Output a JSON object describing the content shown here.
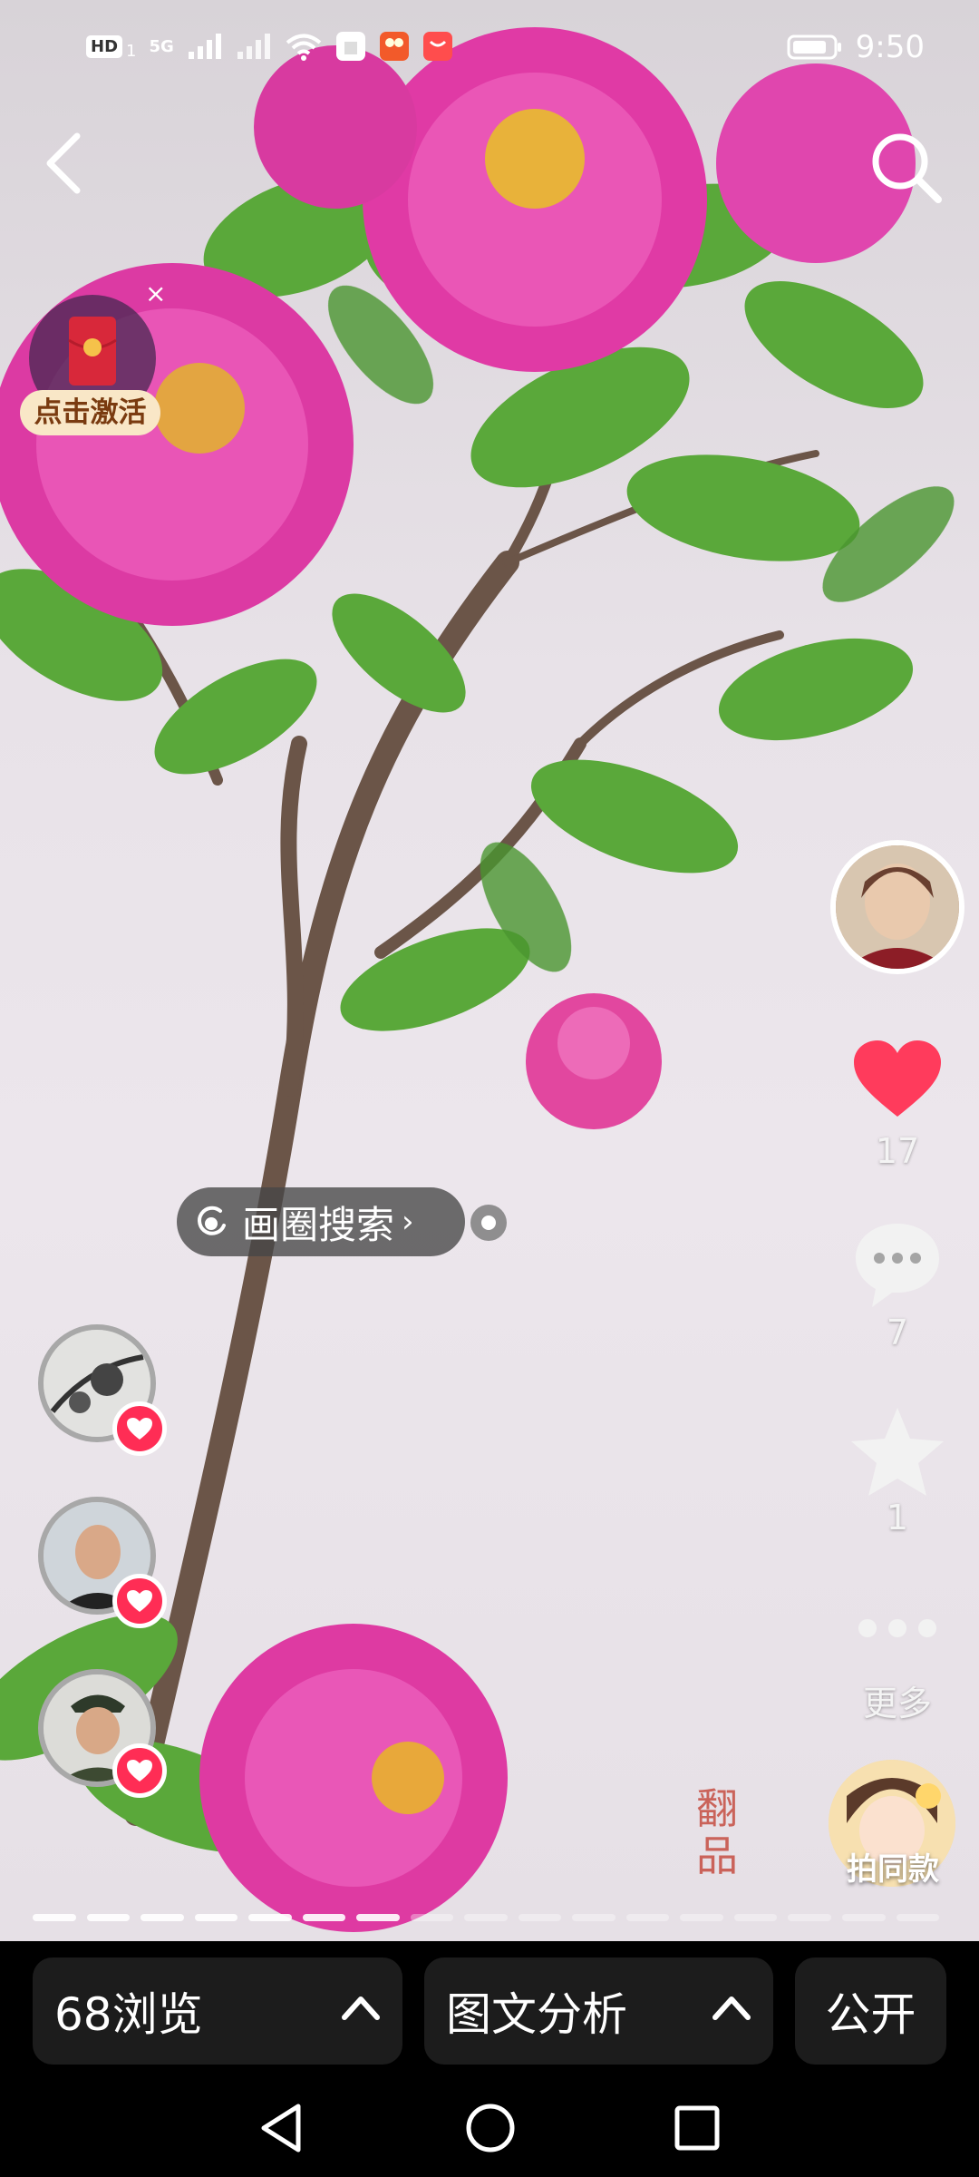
{
  "status_bar": {
    "time": "9:50",
    "network": "5G",
    "hd_label": "HD",
    "sim_index": "1"
  },
  "top": {
    "back_icon": "chevron-left-icon",
    "search_icon": "search-icon"
  },
  "redpacket": {
    "label": "点击激活",
    "close": "×"
  },
  "rail": {
    "like_count": "17",
    "comment_count": "7",
    "favorite_count": "1",
    "more_label": "更多",
    "same_style_label": "拍同款"
  },
  "circle_search": {
    "label": "画圈搜索"
  },
  "watermark": {
    "text": "翻品"
  },
  "progress": {
    "total": 17,
    "current": 7
  },
  "bottom": {
    "views_label": "68浏览",
    "analysis_label": "图文分析",
    "public_label": "公开"
  },
  "colors": {
    "like": "#ff3b5c",
    "badge": "#ff2d55",
    "bar_bg": "#1c1c1c"
  }
}
